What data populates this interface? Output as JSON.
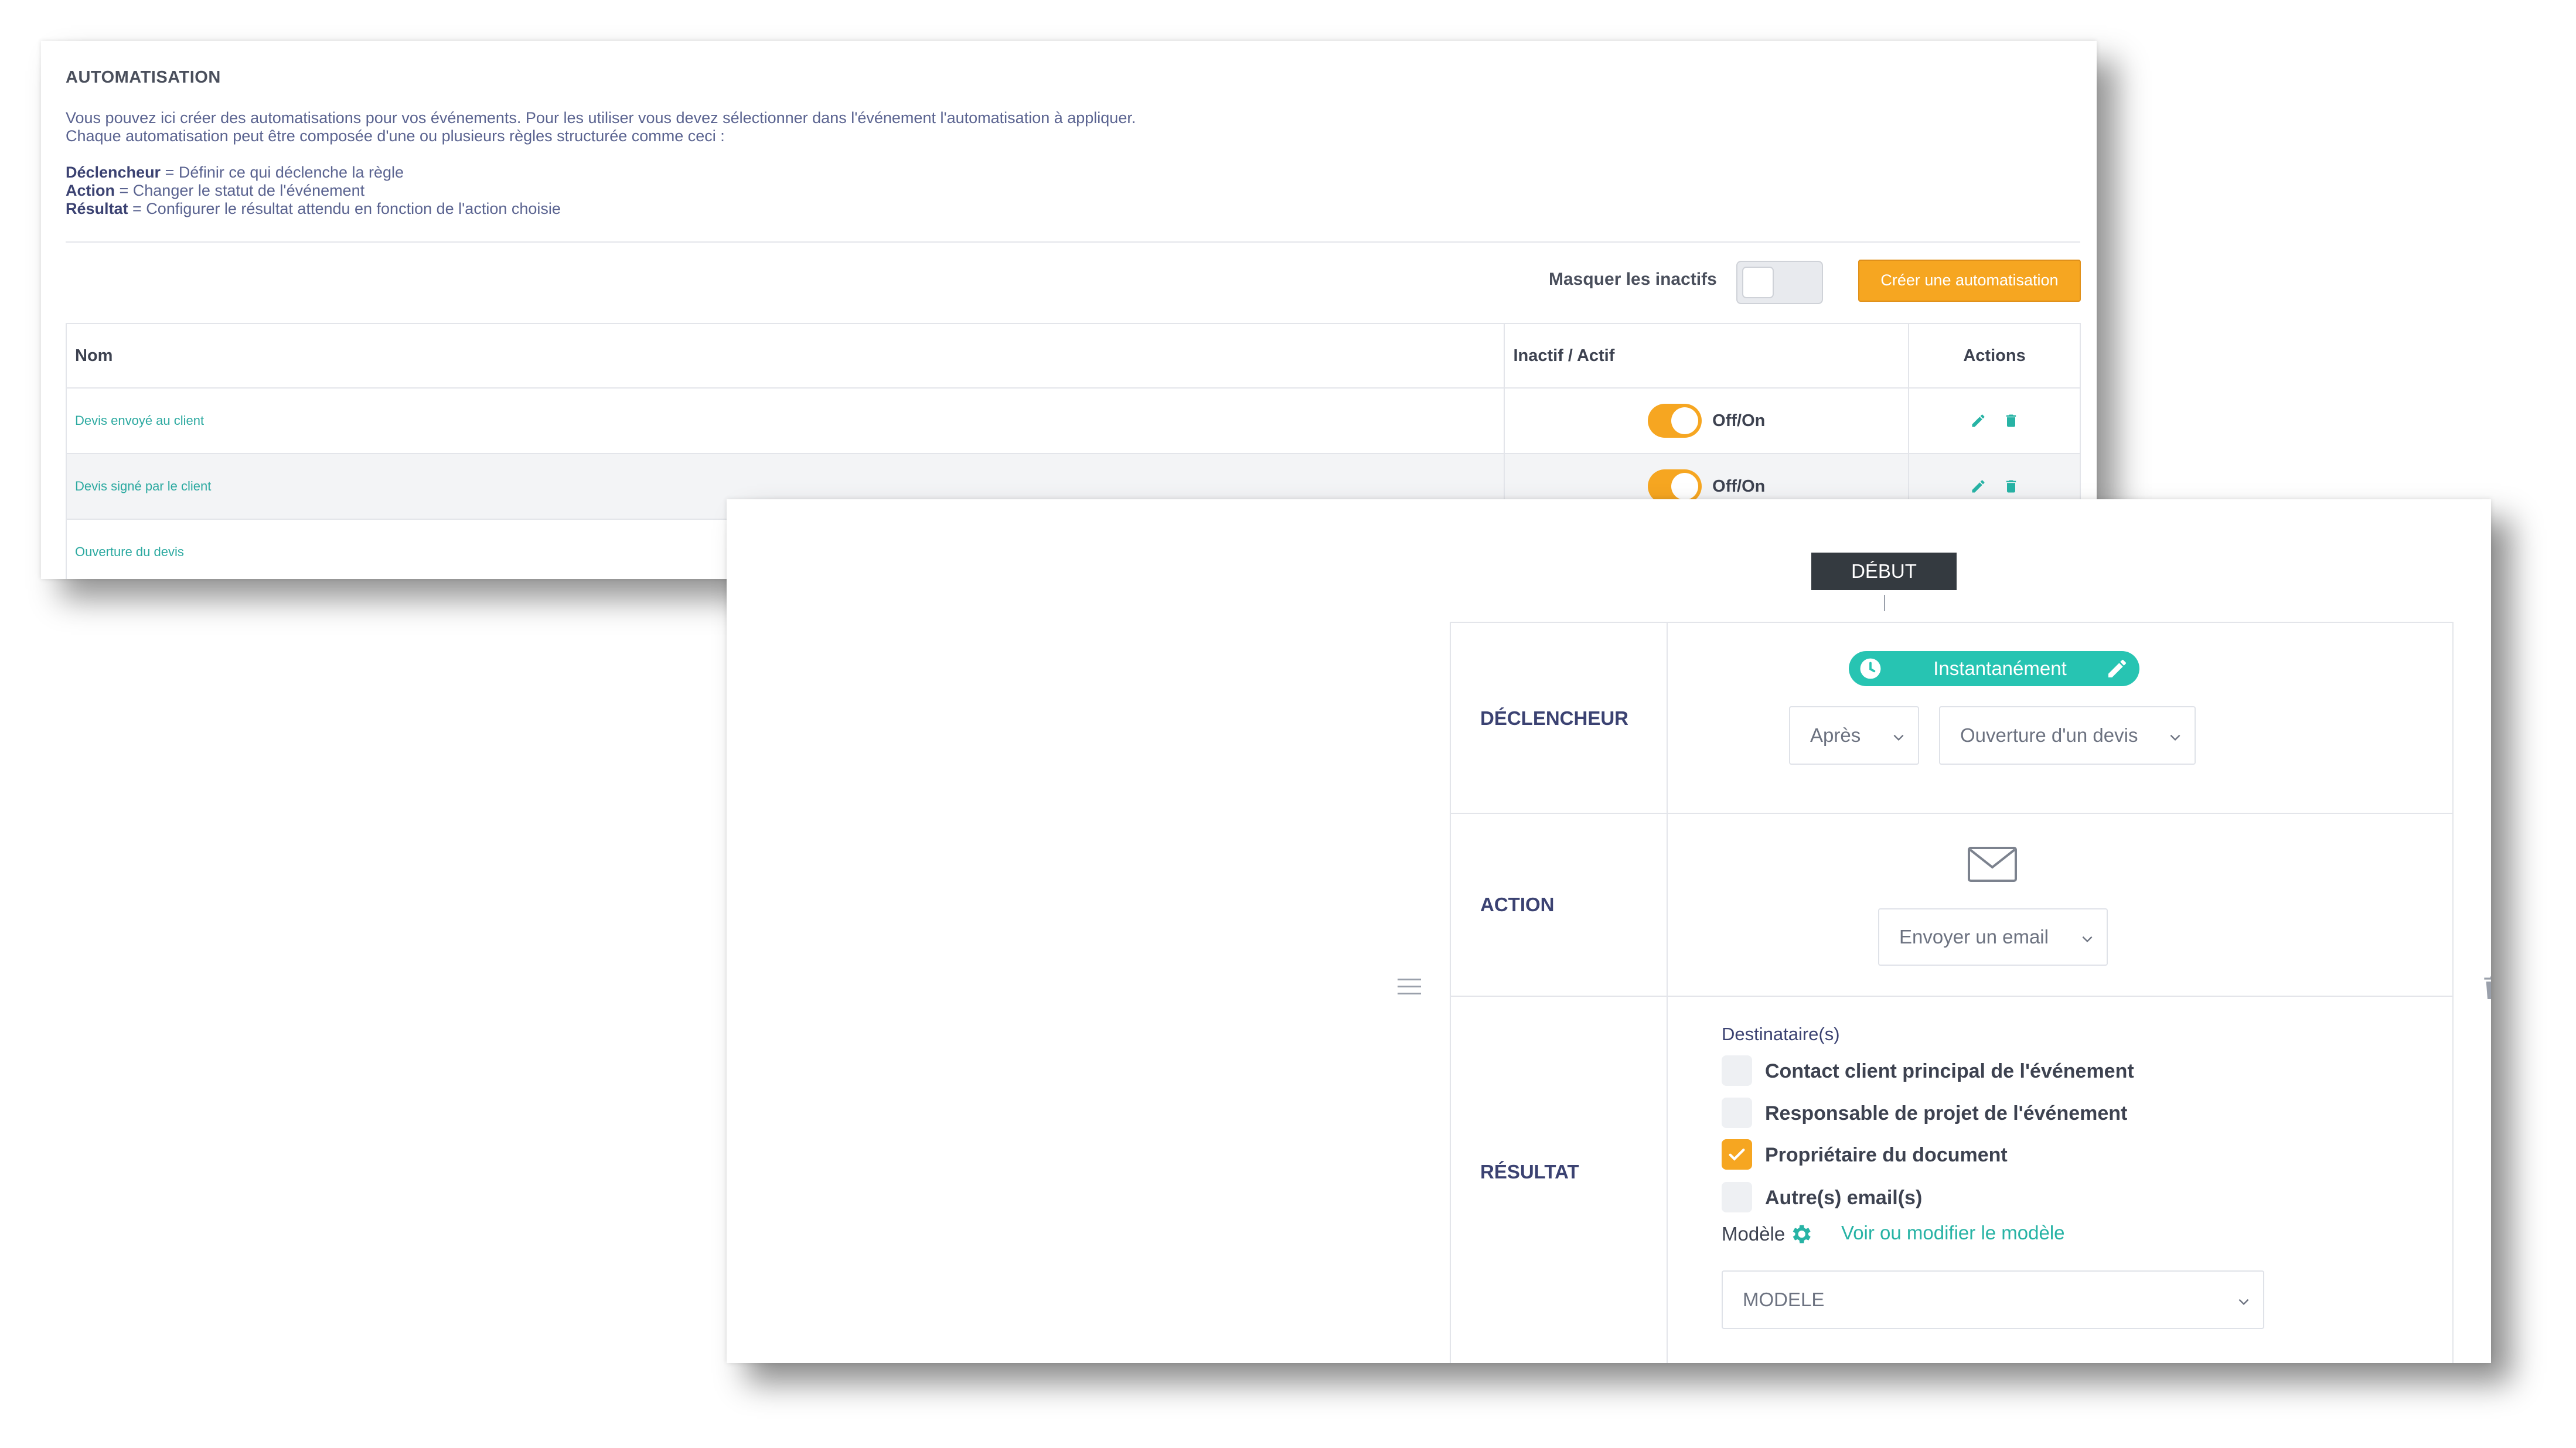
{
  "list_panel": {
    "title": "AUTOMATISATION",
    "description_line1": "Vous pouvez ici créer des automatisations pour vos événements. Pour les utiliser vous devez sélectionner dans l'événement l'automatisation à appliquer.",
    "description_line2": "Chaque automatisation peut être composée d'une ou plusieurs règles structurée comme ceci :",
    "rules": [
      {
        "term": "Déclencheur",
        "definition": " = Définir ce qui déclenche la règle"
      },
      {
        "term": "Action",
        "definition": " = Changer le statut de l'événement"
      },
      {
        "term": "Résultat",
        "definition": " = Configurer le résultat attendu en fonction de l'action choisie"
      }
    ],
    "hide_inactive_label": "Masquer les inactifs",
    "hide_inactive_on": false,
    "create_button": "Créer une automatisation",
    "columns": [
      "Nom",
      "Inactif / Actif",
      "Actions"
    ],
    "rows": [
      {
        "name": "Devis envoyé au client",
        "toggle_label": "Off/On",
        "active": true
      },
      {
        "name": "Devis signé par le client",
        "toggle_label": "Off/On",
        "active": true
      },
      {
        "name": "Ouverture du devis"
      }
    ]
  },
  "editor_panel": {
    "start_label": "DÉBUT",
    "sections": {
      "trigger": "DÉCLENCHEUR",
      "action": "ACTION",
      "result": "RÉSULTAT"
    },
    "trigger": {
      "timing_pill": "Instantanément",
      "relation": "Après",
      "event": "Ouverture d'un devis"
    },
    "action": {
      "icon": "envelope-icon",
      "select": "Envoyer un email"
    },
    "result": {
      "recipients_label": "Destinataire(s)",
      "recipients": [
        {
          "label": "Contact client principal de l'événement",
          "checked": false
        },
        {
          "label": "Responsable de projet de l'événement",
          "checked": false
        },
        {
          "label": "Propriétaire du document",
          "checked": true
        },
        {
          "label": "Autre(s) email(s)",
          "checked": false
        }
      ],
      "template_label": "Modèle",
      "template_link": "Voir ou modifier le modèle",
      "template_select": "MODELE"
    }
  },
  "colors": {
    "accent_orange": "#f6a621",
    "accent_teal": "#27c4b2",
    "link_teal": "#2ba9a0",
    "dark_label": "#343a40"
  }
}
